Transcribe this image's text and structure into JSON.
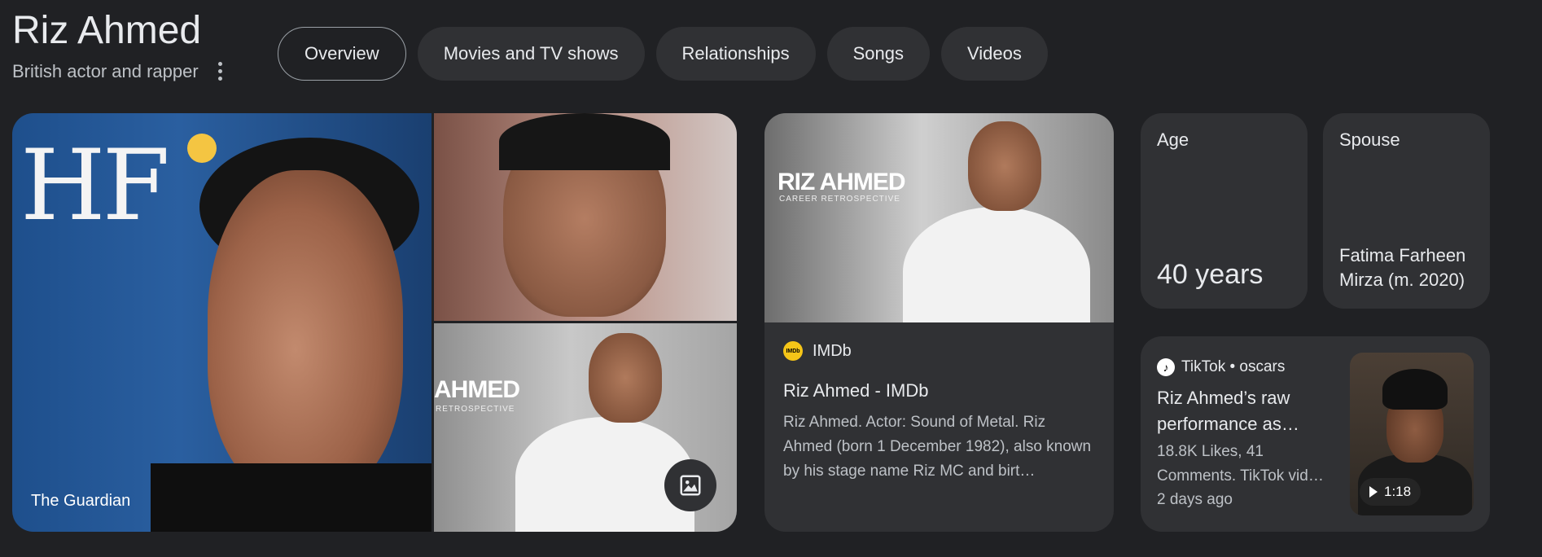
{
  "header": {
    "title": "Riz Ahmed",
    "subtitle": "British actor and rapper"
  },
  "tabs": [
    {
      "label": "Overview",
      "active": true
    },
    {
      "label": "Movies and TV shows",
      "active": false
    },
    {
      "label": "Relationships",
      "active": false
    },
    {
      "label": "Songs",
      "active": false
    },
    {
      "label": "Videos",
      "active": false
    }
  ],
  "images": {
    "main_caption": "The Guardian",
    "main_logo_text": "HF",
    "thumb_label_big": "AHMED",
    "thumb_label_small": "RETROSPECTIVE",
    "more_images_icon": "image-icon"
  },
  "imdb": {
    "thumb_label_big": "RIZ AHMED",
    "thumb_label_small": "CAREER RETROSPECTIVE",
    "favicon_text": "IMDb",
    "source": "IMDb",
    "title": "Riz Ahmed - IMDb",
    "snippet": "Riz Ahmed. Actor: Sound of Metal. Riz Ahmed (born 1 December 1982), also known by his stage name Riz MC and birt…"
  },
  "facts": {
    "age_label": "Age",
    "age_value": "40 years",
    "spouse_label": "Spouse",
    "spouse_value": "Fatima Farheen Mirza (m. 2020)"
  },
  "tiktok": {
    "source": "TikTok • oscars",
    "title": "Riz Ahmed’s raw performance as…",
    "meta": "18.8K Likes, 41 Comments. TikTok vid…",
    "time": "2 days ago",
    "duration": "1:18"
  },
  "colors": {
    "background": "#202124",
    "card": "#303134",
    "text": "#e8eaed",
    "muted": "#bdc1c6",
    "imdb_yellow": "#f5c518"
  }
}
